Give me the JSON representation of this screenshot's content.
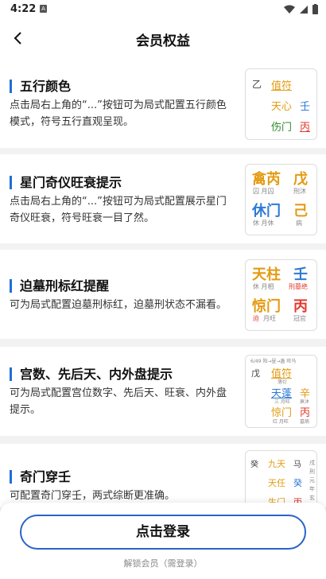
{
  "status": {
    "time": "4:22"
  },
  "header": {
    "title": "会员权益"
  },
  "cards": [
    {
      "title": "五行颜色",
      "desc": "点击局右上角的“...”按钮可为局式配置五行颜色模式，符号五行直观呈现。"
    },
    {
      "title": "星门奇仪旺衰提示",
      "desc": "点击局右上角的“...”按钮可为局式配置展示星门奇仪旺衰，符号旺衰一目了然。"
    },
    {
      "title": "迫墓刑标红提醒",
      "desc": "可为局式配置迫墓刑标红，迫墓刑状态不漏看。"
    },
    {
      "title": "宫数、先后天、内外盘提示",
      "desc": "可为局式配置宫位数字、先后天、旺衰、内外盘提示。"
    },
    {
      "title": "奇门穿壬",
      "desc": "可配置奇门穿壬，两式综断更准确。"
    }
  ],
  "preview1": {
    "yi": "乙",
    "zhifu": "值符",
    "tianxin": "天心",
    "ren": "壬",
    "shangmen": "伤门",
    "bing": "丙"
  },
  "preview2": {
    "qinrui": "禽芮",
    "wu": "戊",
    "sub1": "囚 月囚",
    "sub2": "刑沐",
    "xiumen": "休门",
    "ji": "己",
    "sub3": "休 月休",
    "sub4": "病"
  },
  "preview3": {
    "tianzhu": "天柱",
    "ren": "壬",
    "sub1": "休 月相",
    "sub2": "刑墓绝",
    "jingmen": "惊门",
    "bing": "丙",
    "sub3": "迫",
    "sub3b": "月旺",
    "sub4": "冠官"
  },
  "preview4": {
    "top": "6/49 阳→昼→蛊 旺马",
    "wu": "戊",
    "zhifu": "值符",
    "sub0": "落衍",
    "tianpeng": "天蓬",
    "xin": "辛",
    "sub1": "三 月旺",
    "sub2": "衰沐",
    "jingmen": "惊门",
    "bing": "丙",
    "sub3": "红 月旺",
    "sub4": "墓病"
  },
  "preview5": {
    "gui": "癸",
    "jiutian": "九天",
    "ma": "马",
    "tianren": "天任",
    "gui2": "癸",
    "shengmen": "生门",
    "bing": "丙",
    "side": "戌 刑 元 年 玄"
  },
  "bottom": {
    "login": "点击登录",
    "sub": "解锁会员（需登录）"
  },
  "colors": {
    "accent": "#1f6fd6",
    "gold": "#e49b12",
    "red": "#e23b2e",
    "green": "#2e8b2e",
    "blue": "#2e7ad6"
  }
}
